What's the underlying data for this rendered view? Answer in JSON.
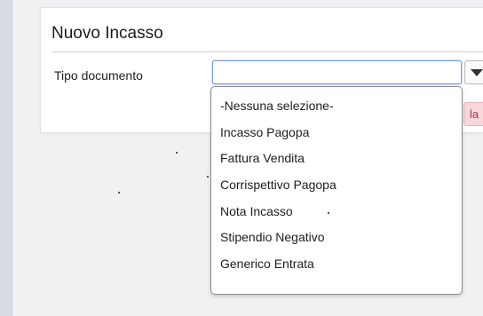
{
  "form": {
    "title": "Nuovo Incasso",
    "field_label": "Tipo documento",
    "selected_value": "",
    "partial_button_text": "la"
  },
  "dropdown": {
    "options": [
      "-Nessuna selezione-",
      "Incasso Pagopa",
      "Fattura Vendita",
      "Corrispettivo Pagopa",
      "Nota Incasso",
      "Stipendio Negativo",
      "Generico Entrata"
    ]
  },
  "icons": {
    "dropdown_caret": "chevron-down-icon"
  },
  "colors": {
    "focus_border": "#7a99d8",
    "danger_button_bg": "#f8d7db",
    "danger_button_text": "#b0323f",
    "left_rail": "#d7dce6"
  }
}
